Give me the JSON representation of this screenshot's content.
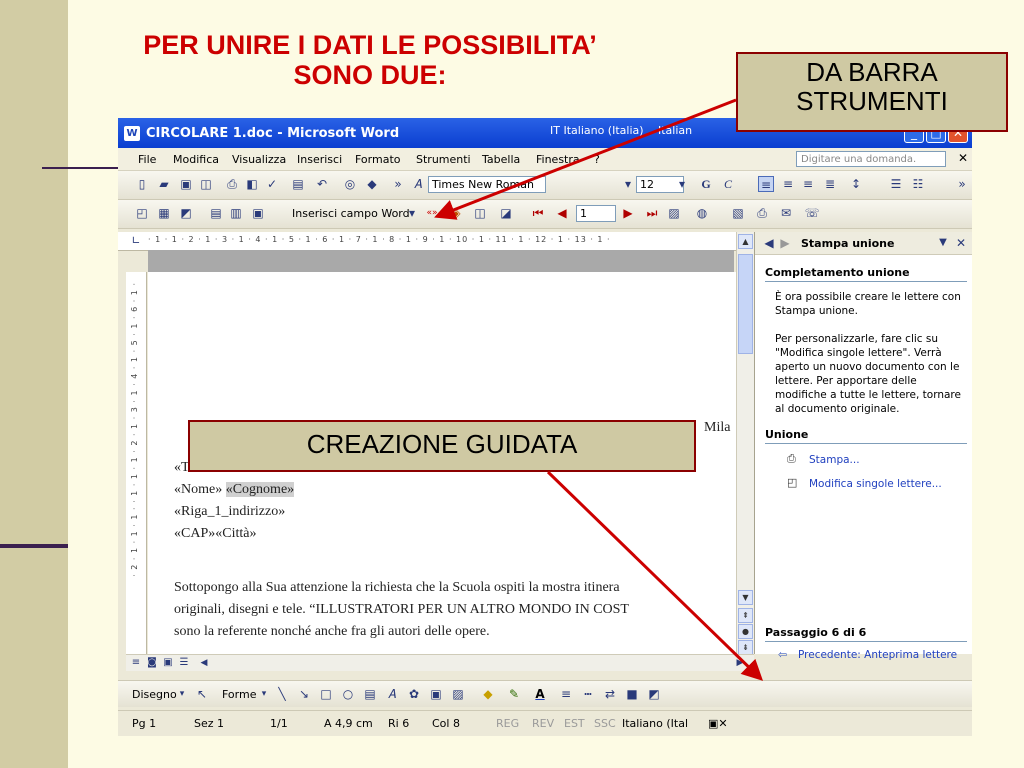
{
  "slide": {
    "title_line1": "PER UNIRE I DATI LE POSSIBILITA’",
    "title_line2": "SONO DUE:",
    "callout_toolbar_line1": "DA BARRA",
    "callout_toolbar_line2": "STRUMENTI",
    "callout_wizard": "CREAZIONE  GUIDATA",
    "accent_color": "#cc0000"
  },
  "window": {
    "app_icon": "W",
    "title": "CIRCOLARE 1.doc - Microsoft Word",
    "lang_indicator": "IT Italiano (Italia)",
    "lang_indicator2": "Italian",
    "minimize": "_",
    "maximize": "□",
    "close": "✕"
  },
  "menubar": {
    "items": [
      "File",
      "Modifica",
      "Visualizza",
      "Inserisci",
      "Formato",
      "Strumenti",
      "Tabella",
      "Finestra",
      "?"
    ],
    "help_placeholder": "Digitare una domanda.",
    "close_doc": "✕"
  },
  "toolbar_formatting": {
    "font_name": "Times New Roman",
    "font_size": "12",
    "bold": "G",
    "italic": "C"
  },
  "toolbar_mailmerge": {
    "insert_field": "Inserisci campo Word",
    "record_number": "1"
  },
  "ruler": {
    "marks": "· 1 · 1 · 2 · 1 · 3 · 1 · 4 · 1 · 5 · 1 · 6 · 1 · 7 · 1 · 8 · 1 · 9 · 1 · 10 · 1 · 11 · 1 · 12 · 1 · 13 · 1 ·",
    "vmarks": "· 2 · 1 · 1 · 1 · · 1 · 1 · 1 · 2 · 1 · 3 · 1 · 4 · 1 · 5 · 1 · 6 · 1 ·"
  },
  "document": {
    "date_place": "Mila",
    "field_title": "«T",
    "field_nome": "«Nome»",
    "field_cognome": "«Cognome»",
    "field_address": "«Riga_1_indirizzo»",
    "field_cap_city": "«CAP»«Città»",
    "body_line1": "Sottopongo alla Sua attenzione la richiesta che la Scuola ospiti la mostra itinera",
    "body_line2": "originali, disegni e tele. “ILLUSTRATORI PER UN ALTRO MONDO IN COST",
    "body_line3": "sono la referente nonché anche fra gli autori  delle opere."
  },
  "taskpane": {
    "title": "Stampa unione",
    "section_complete": "Completamento unione",
    "text1": "È ora possibile creare le lettere con Stampa unione.",
    "text2": "Per personalizzarle, fare clic su \"Modifica singole lettere\". Verrà aperto un nuovo documento con le lettere. Per apportare delle modifiche a tutte le lettere, tornare al documento originale.",
    "section_merge": "Unione",
    "link_print": "Stampa...",
    "link_edit": "Modifica singole lettere...",
    "step": "Passaggio 6 di 6",
    "link_prev": "Precedente: Anteprima lettere"
  },
  "drawbar": {
    "draw": "Disegno",
    "shapes": "Forme"
  },
  "statusbar": {
    "page": "Pg  1",
    "section": "Sez  1",
    "pages": "1/1",
    "position": "A  4,9 cm",
    "line": "Ri  6",
    "column": "Col  8",
    "rec": "REG",
    "rev": "REV",
    "ext": "EST",
    "ovr": "SSC",
    "language": "Italiano (Ital"
  }
}
